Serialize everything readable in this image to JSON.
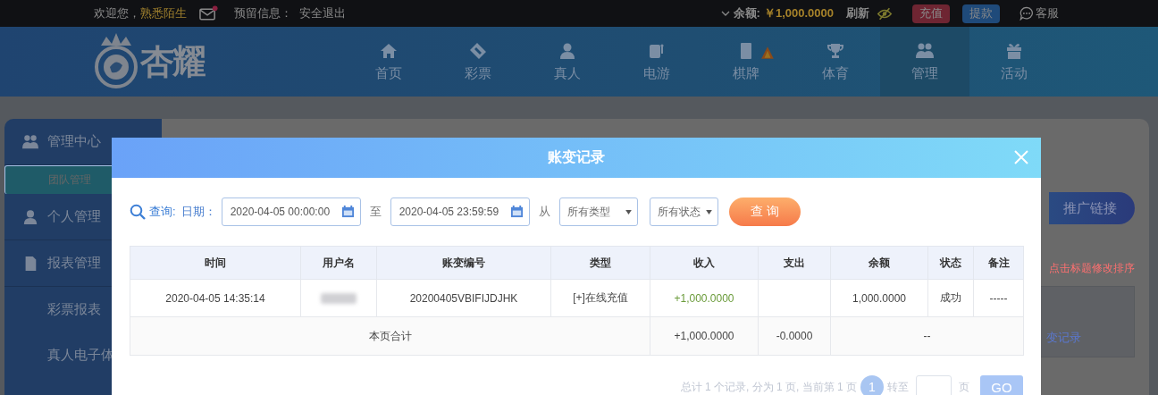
{
  "top_bar": {
    "greeting": "欢迎您，",
    "username": "熟悉陌生",
    "mail_unread": true,
    "reserved_info_label": "预留信息：",
    "logout": "安全退出",
    "balance_label": "余额:",
    "balance": "￥1,000.0000",
    "refresh": "刷新",
    "deposit": "充值",
    "withdraw": "提款",
    "support": "客服"
  },
  "logo": {
    "text": "杏耀"
  },
  "nav": [
    {
      "label": "首页",
      "hot": false,
      "selected": false
    },
    {
      "label": "彩票",
      "hot": false,
      "selected": false
    },
    {
      "label": "真人",
      "hot": false,
      "selected": false
    },
    {
      "label": "电游",
      "hot": false,
      "selected": false
    },
    {
      "label": "棋牌",
      "hot": true,
      "selected": false
    },
    {
      "label": "体育",
      "hot": false,
      "selected": false
    },
    {
      "label": "管理",
      "hot": false,
      "selected": true
    },
    {
      "label": "活动",
      "hot": false,
      "selected": false
    }
  ],
  "sidebar": {
    "items": [
      {
        "label": "管理中心",
        "kind": "header",
        "selected": false
      },
      {
        "label": "团队管理",
        "kind": "sub",
        "selected": true
      },
      {
        "label": "个人管理",
        "kind": "header",
        "selected": false
      },
      {
        "label": "报表管理",
        "kind": "header",
        "selected": false
      },
      {
        "label": "彩票报表",
        "kind": "sub",
        "selected": false
      },
      {
        "label": "真人电子体",
        "kind": "sub",
        "selected": false
      }
    ]
  },
  "behind_panel": {
    "promo_button": "推广链接",
    "sort_hint": "点击标题修改排序",
    "link": "变记录"
  },
  "dialog": {
    "title": "账变记录",
    "filter": {
      "query_label": "查询:",
      "date_label": "日期：",
      "start": "2020-04-05 00:00:00",
      "to": "至",
      "end": "2020-04-05 23:59:59",
      "from": "从",
      "type_select": "所有类型",
      "status_select": "所有状态",
      "search_button": "查 询"
    },
    "table": {
      "columns": [
        "时间",
        "用户名",
        "账变编号",
        "类型",
        "收入",
        "支出",
        "余额",
        "状态",
        "备注"
      ],
      "rows": [
        {
          "cells": [
            {
              "kind": "text",
              "text": "2020-04-05 14:35:14"
            },
            {
              "kind": "redacted"
            },
            {
              "kind": "text",
              "text": "20200405VBIFIJDJHK"
            },
            {
              "kind": "text",
              "text": "[+]在线充值"
            },
            {
              "kind": "income",
              "text": "+1,000.0000"
            },
            {
              "kind": "empty"
            },
            {
              "kind": "text",
              "text": "1,000.0000"
            },
            {
              "kind": "text",
              "text": "成功"
            },
            {
              "kind": "text",
              "text": "-----"
            }
          ]
        }
      ],
      "total": {
        "label": "本页合计",
        "income": "+1,000.0000",
        "expense": "-0.0000",
        "rest": "--"
      }
    },
    "pagination": {
      "summary": "总计 1 个记录, 分为 1 页, 当前第 1 页",
      "pages": [
        {
          "label": "1",
          "selected": true
        }
      ],
      "goto_label": "转至",
      "page_unit": "页",
      "go": "GO"
    }
  }
}
